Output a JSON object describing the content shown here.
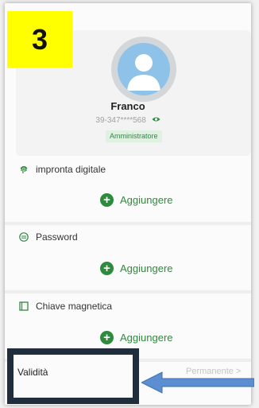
{
  "step_number": "3",
  "user": {
    "name": "Franco",
    "phone": "39-347****568",
    "role": "Amministratore"
  },
  "sections": [
    {
      "id": "fingerprint",
      "title": "impronta digitale",
      "add_label": "Aggiungere",
      "icon": "fingerprint-icon"
    },
    {
      "id": "password",
      "title": "Password",
      "add_label": "Aggiungere",
      "icon": "password-icon"
    },
    {
      "id": "card",
      "title": "Chiave magnetica",
      "add_label": "Aggiungere",
      "icon": "card-icon"
    }
  ],
  "validity": {
    "label": "Validità",
    "value": "Permanente >"
  },
  "colors": {
    "accent": "#2e8a3c",
    "highlight": "#ffff00",
    "frame": "#1f2d3d",
    "arrow": "#5b8fd1"
  }
}
